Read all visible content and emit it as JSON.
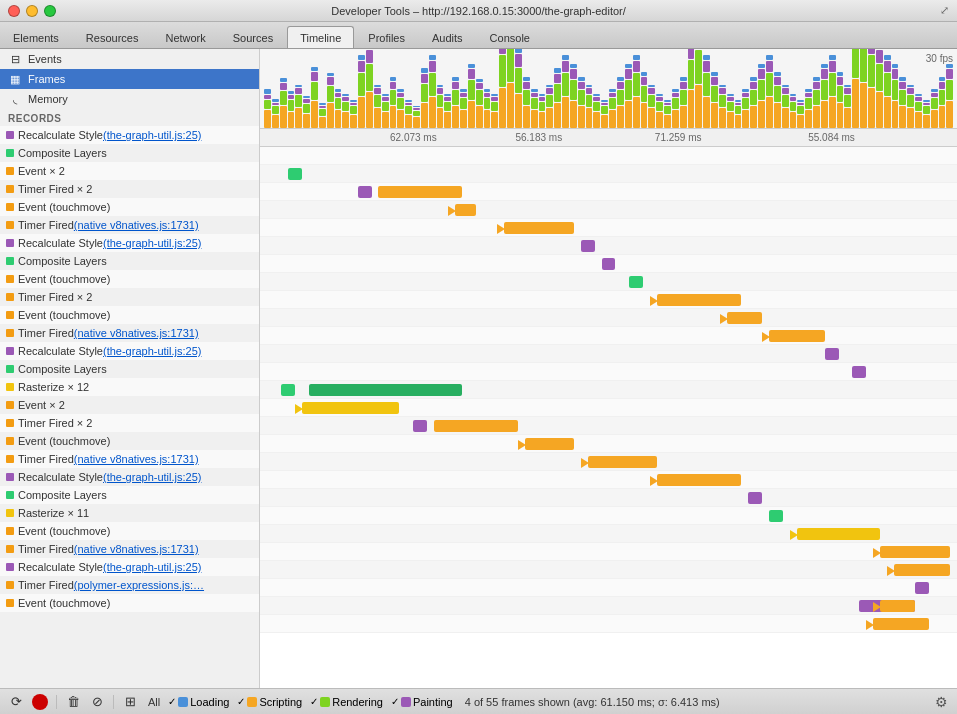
{
  "titlebar": {
    "title": "Developer Tools – http://192.168.0.15:3000/the-graph-editor/"
  },
  "tabs": [
    {
      "label": "Elements",
      "active": false
    },
    {
      "label": "Resources",
      "active": false
    },
    {
      "label": "Network",
      "active": false
    },
    {
      "label": "Sources",
      "active": false
    },
    {
      "label": "Timeline",
      "active": true
    },
    {
      "label": "Profiles",
      "active": false
    },
    {
      "label": "Audits",
      "active": false
    },
    {
      "label": "Console",
      "active": false
    }
  ],
  "sidebar": {
    "items": [
      {
        "label": "Events",
        "icon": "⊟",
        "active": false
      },
      {
        "label": "Frames",
        "icon": "▦",
        "active": true
      },
      {
        "label": "Memory",
        "icon": "◟",
        "active": false
      }
    ]
  },
  "records_label": "RECORDS",
  "records": [
    {
      "label": "Recalculate Style",
      "link": "(the-graph-util.js:25)",
      "color": "#9b59b6",
      "indent": 0
    },
    {
      "label": "Composite Layers",
      "link": "",
      "color": "#2ecc71",
      "indent": 0
    },
    {
      "label": "Event × 2",
      "link": "",
      "color": "#f39c12",
      "indent": 0
    },
    {
      "label": "Timer Fired × 2",
      "link": "",
      "color": "#f39c12",
      "indent": 0
    },
    {
      "label": "Event (touchmove)",
      "link": "",
      "color": "#f39c12",
      "indent": 0
    },
    {
      "label": "Timer Fired ",
      "link": "(native v8natives.js:1731)",
      "color": "#f39c12",
      "indent": 0
    },
    {
      "label": "Recalculate Style",
      "link": "(the-graph-util.js:25)",
      "color": "#9b59b6",
      "indent": 0
    },
    {
      "label": "Composite Layers",
      "link": "",
      "color": "#2ecc71",
      "indent": 0
    },
    {
      "label": "Event (touchmove)",
      "link": "",
      "color": "#f39c12",
      "indent": 0
    },
    {
      "label": "Timer Fired × 2",
      "link": "",
      "color": "#f39c12",
      "indent": 0
    },
    {
      "label": "Event (touchmove)",
      "link": "",
      "color": "#f39c12",
      "indent": 0
    },
    {
      "label": "Timer Fired ",
      "link": "(native v8natives.js:1731)",
      "color": "#f39c12",
      "indent": 0
    },
    {
      "label": "Recalculate Style",
      "link": "(the-graph-util.js:25)",
      "color": "#9b59b6",
      "indent": 0
    },
    {
      "label": "Composite Layers",
      "link": "",
      "color": "#2ecc71",
      "indent": 0
    },
    {
      "label": "Rasterize × 12",
      "link": "",
      "color": "#f1c40f",
      "indent": 0
    },
    {
      "label": "Event × 2",
      "link": "",
      "color": "#f39c12",
      "indent": 0
    },
    {
      "label": "Timer Fired × 2",
      "link": "",
      "color": "#f39c12",
      "indent": 0
    },
    {
      "label": "Event (touchmove)",
      "link": "",
      "color": "#f39c12",
      "indent": 0
    },
    {
      "label": "Timer Fired ",
      "link": "(native v8natives.js:1731)",
      "color": "#f39c12",
      "indent": 0
    },
    {
      "label": "Recalculate Style",
      "link": "(the-graph-util.js:25)",
      "color": "#9b59b6",
      "indent": 0
    },
    {
      "label": "Composite Layers",
      "link": "",
      "color": "#2ecc71",
      "indent": 0
    },
    {
      "label": "Rasterize × 11",
      "link": "",
      "color": "#f1c40f",
      "indent": 0
    },
    {
      "label": "Event (touchmove)",
      "link": "",
      "color": "#f39c12",
      "indent": 0
    },
    {
      "label": "Timer Fired ",
      "link": "(native v8natives.js:1731)",
      "color": "#f39c12",
      "indent": 0
    },
    {
      "label": "Recalculate Style",
      "link": "(the-graph-util.js:25)",
      "color": "#9b59b6",
      "indent": 0
    },
    {
      "label": "Timer Fired ",
      "link": "(polymer-expressions.js:…",
      "color": "#f39c12",
      "indent": 0
    },
    {
      "label": "Event (touchmove)",
      "link": "",
      "color": "#f39c12",
      "indent": 0
    }
  ],
  "timeline_markers": [
    {
      "label": "62.073 ms",
      "pct": 22
    },
    {
      "label": "56.183 ms",
      "pct": 40
    },
    {
      "label": "71.259 ms",
      "pct": 60
    },
    {
      "label": "55.084 ms",
      "pct": 82
    }
  ],
  "fps_label": "30 fps",
  "bottom": {
    "status": "4 of 55 frames shown (avg: 61.150 ms; σ: 6.413 ms)",
    "checkboxes": [
      {
        "label": "Loading",
        "color": "#4a90d9",
        "checked": true
      },
      {
        "label": "Scripting",
        "color": "#f5a623",
        "checked": true
      },
      {
        "label": "Rendering",
        "color": "#7ed321",
        "checked": true
      },
      {
        "label": "Painting",
        "color": "#9b59b6",
        "checked": true
      }
    ],
    "all_label": "All"
  }
}
